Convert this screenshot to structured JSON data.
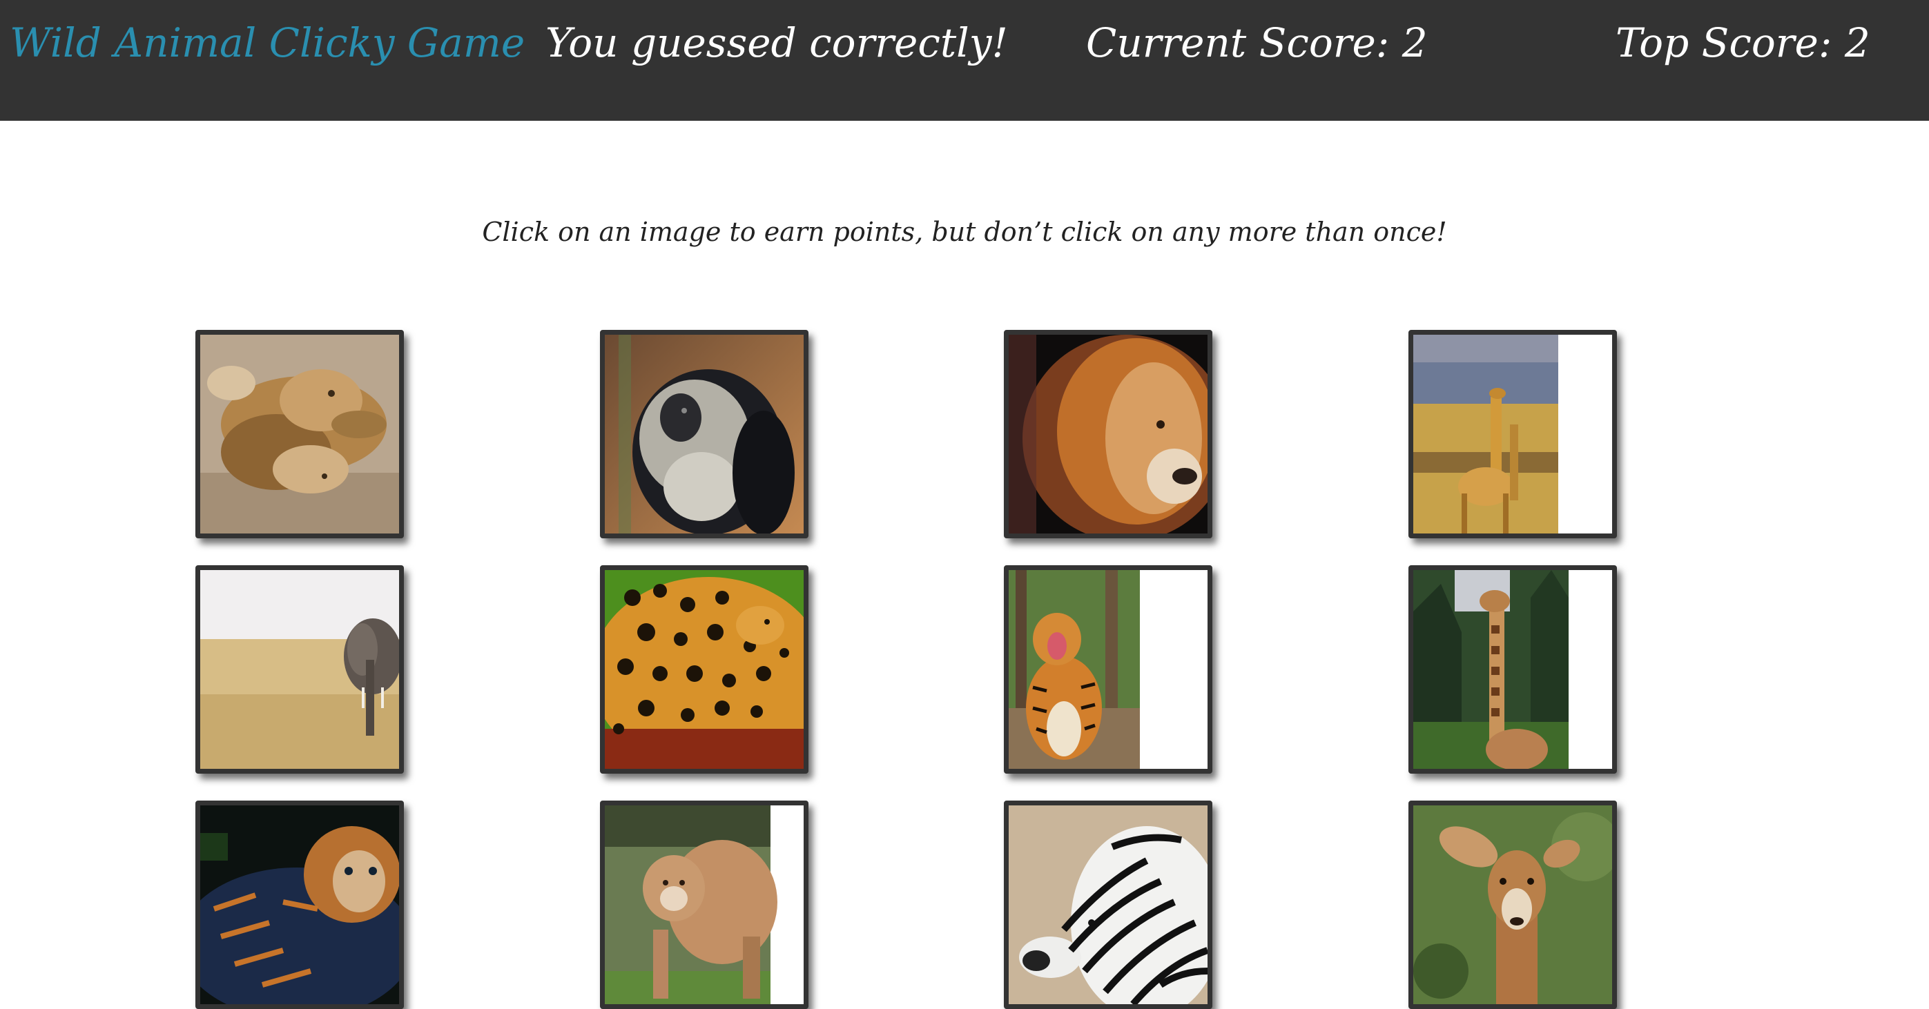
{
  "navbar": {
    "brand": "Wild Animal Clicky Game",
    "message": "You guessed correctly!",
    "current_score": "Current Score: 2",
    "top_score": "Top Score: 2",
    "colors": {
      "background": "#333333",
      "brand": "#2a8fb0",
      "text": "#ffffff"
    }
  },
  "instructions": "Click on an image to earn points, but don’t click on any more than once!",
  "cards": [
    {
      "animal": "lions"
    },
    {
      "animal": "monkey"
    },
    {
      "animal": "lion"
    },
    {
      "animal": "giraffes"
    },
    {
      "animal": "elephant"
    },
    {
      "animal": "jaguar"
    },
    {
      "animal": "tiger"
    },
    {
      "animal": "giraffe"
    },
    {
      "animal": "tiger"
    },
    {
      "animal": "cougar"
    },
    {
      "animal": "zebras"
    },
    {
      "animal": "gazelle"
    }
  ]
}
